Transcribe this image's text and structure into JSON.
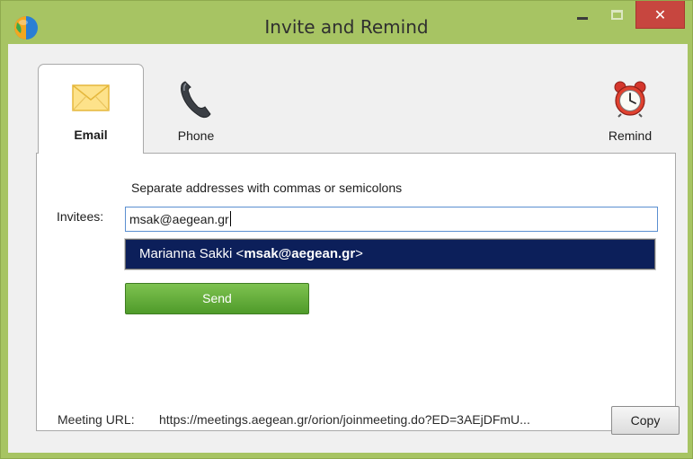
{
  "window": {
    "title": "Invite and Remind",
    "close_glyph": "✕",
    "app_icon": "globe-icon"
  },
  "tabs": [
    {
      "label": "Email",
      "icon": "envelope-icon",
      "selected": true
    },
    {
      "label": "Phone",
      "icon": "telephone-handset-icon",
      "selected": false
    },
    {
      "label": "Remind",
      "icon": "alarm-clock-icon",
      "selected": false
    }
  ],
  "email_panel": {
    "hint": "Separate addresses with commas or semicolons",
    "invitees_label": "Invitees:",
    "invitees_value": "msak@aegean.gr",
    "suggestion": {
      "name": "Marianna Sakki <",
      "email": "msak@aegean.gr",
      "suffix": ">"
    },
    "send_label": "Send"
  },
  "footer": {
    "meeting_url_label": "Meeting URL:",
    "meeting_url_value": "https://meetings.aegean.gr/orion/joinmeeting.do?ED=3AEjDFmU...",
    "copy_label": "Copy"
  },
  "colors": {
    "frame": "#a7c463",
    "close_button": "#c7463f",
    "suggestion_highlight": "#0c1f5a",
    "send_button": "#5ca535",
    "input_focus_border": "#5b8fd0"
  }
}
